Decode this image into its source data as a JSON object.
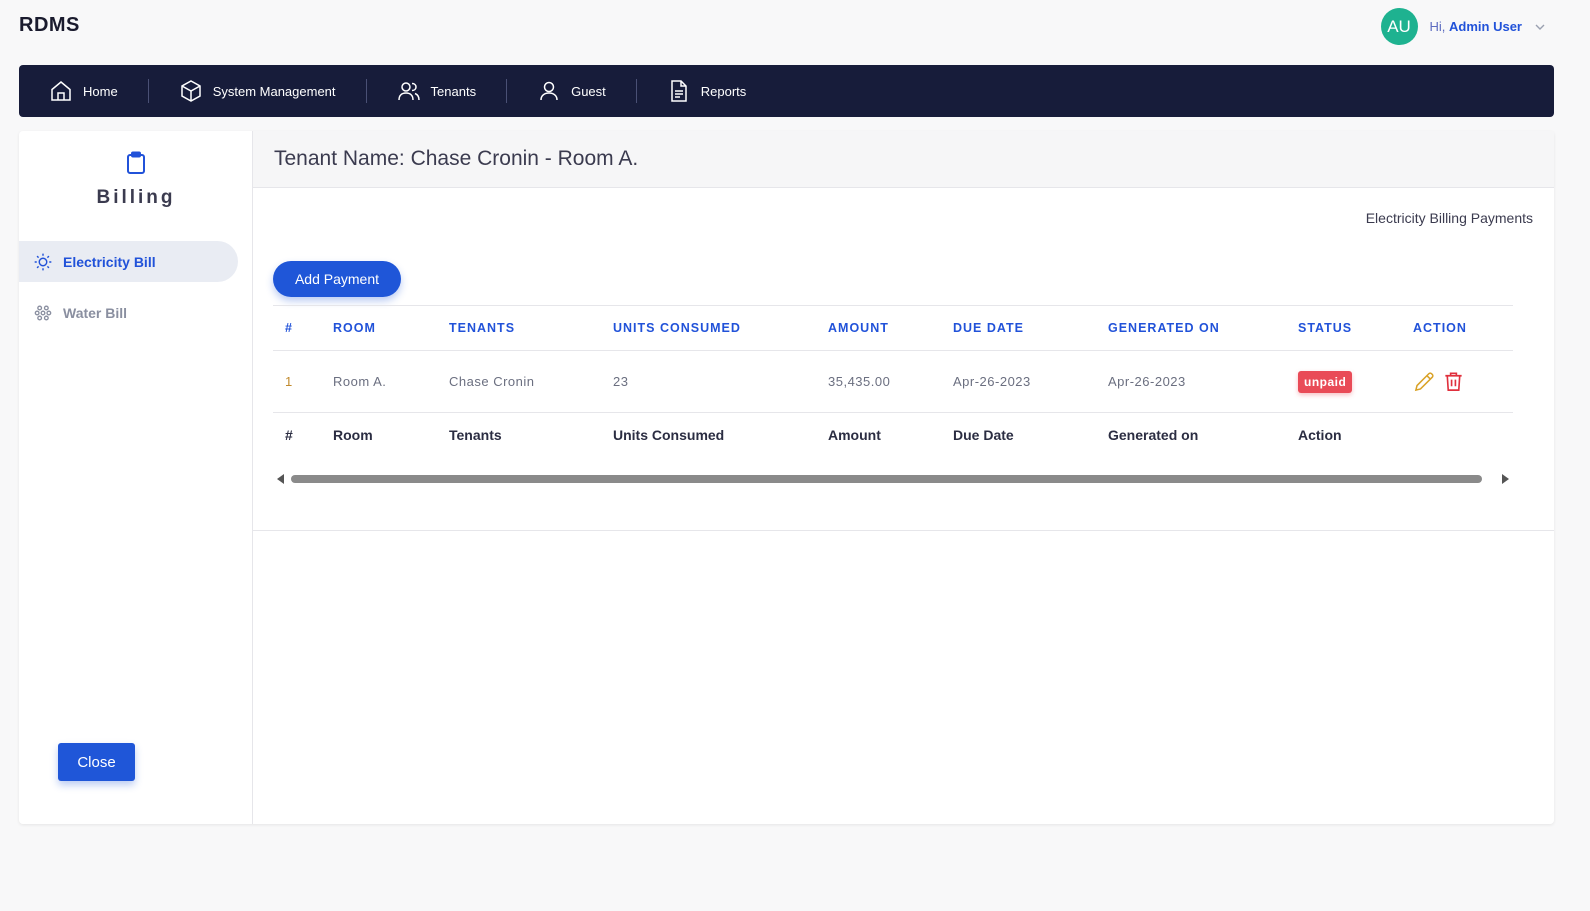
{
  "app": {
    "brand": "RDMS"
  },
  "user": {
    "initials": "AU",
    "greeting": "Hi,",
    "name": "Admin User"
  },
  "nav": {
    "items": [
      {
        "label": "Home",
        "icon": "home-icon"
      },
      {
        "label": "System Management",
        "icon": "cube-icon"
      },
      {
        "label": "Tenants",
        "icon": "users-icon"
      },
      {
        "label": "Guest",
        "icon": "user-icon"
      },
      {
        "label": "Reports",
        "icon": "document-icon"
      }
    ]
  },
  "sidebar": {
    "title": "Billing",
    "icon": "clipboard-icon",
    "items": [
      {
        "label": "Electricity Bill",
        "icon": "sun-icon",
        "active": true
      },
      {
        "label": "Water Bill",
        "icon": "water-icon",
        "active": false
      }
    ],
    "close_label": "Close"
  },
  "panel": {
    "header": "Tenant Name: Chase Cronin - Room A.",
    "subtitle": "Electricity Billing Payments",
    "add_label": "Add Payment"
  },
  "table": {
    "columns": [
      "#",
      "ROOM",
      "TENANTS",
      "UNITS CONSUMED",
      "AMOUNT",
      "DUE DATE",
      "GENERATED ON",
      "STATUS",
      "ACTION"
    ],
    "rows": [
      {
        "idx": "1",
        "room": "Room A.",
        "tenant": "Chase Cronin",
        "units": "23",
        "amount": "35,435.00",
        "due": "Apr-26-2023",
        "generated": "Apr-26-2023",
        "status": "unpaid"
      }
    ],
    "footer": [
      "#",
      "Room",
      "Tenants",
      "Units Consumed",
      "Amount",
      "Due Date",
      "Generated on",
      "Action"
    ]
  },
  "colors": {
    "navbar": "#171c3a",
    "accent": "#1f56d8",
    "status_unpaid": "#e94b57",
    "edit_icon": "#d9a227",
    "delete_icon": "#e0303d",
    "avatar": "#1eb290"
  }
}
